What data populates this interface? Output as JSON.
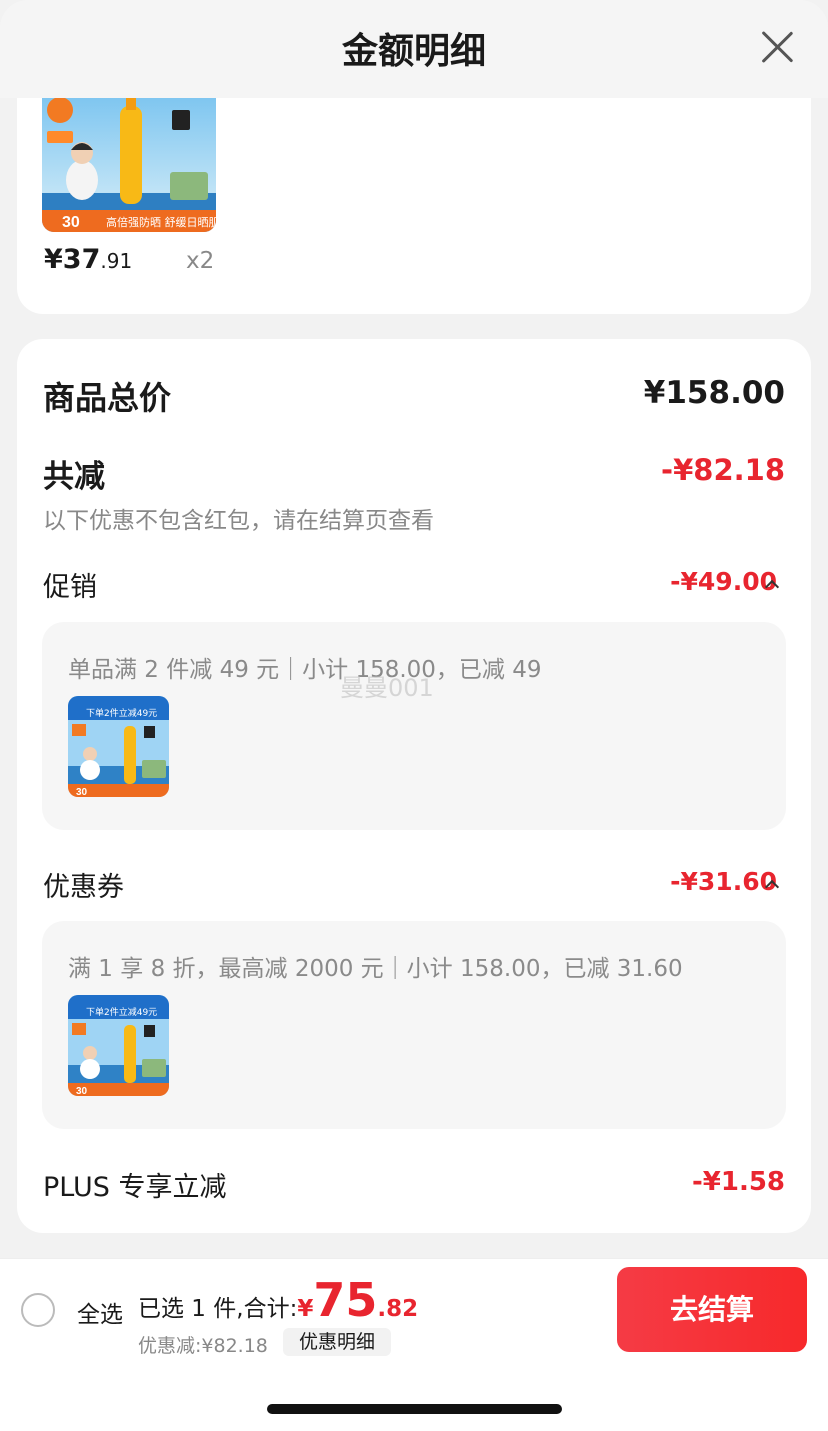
{
  "header": {
    "title": "金额明细"
  },
  "product": {
    "price_int": "¥37",
    "price_dec": ".91",
    "quantity": "x2"
  },
  "summary": {
    "total_label": "商品总价",
    "total_value": "¥158.00",
    "reduce_label": "共减",
    "reduce_value": "-¥82.18",
    "reduce_note": "以下优惠不包含红包，请在结算页查看"
  },
  "promotion": {
    "label": "促销",
    "value": "-¥49.00",
    "detail": "单品满 2 件减 49 元｜小计 158.00，已减 49"
  },
  "coupon": {
    "label": "优惠券",
    "value": "-¥31.60",
    "detail": "满 1 享 8 折，最高减 2000 元｜小计 158.00，已减 31.60"
  },
  "plus": {
    "label": "PLUS 专享立减",
    "value": "-¥1.58"
  },
  "watermark": "曼曼001",
  "bottom": {
    "select_all": "全选",
    "selected_text": "已选 1 件,合计:",
    "currency": "¥",
    "total_int": "75",
    "total_dec": ".82",
    "discount_text": "优惠减:¥82.18",
    "detail_button": "优惠明细",
    "checkout_button": "去结算"
  },
  "colors": {
    "accent_red": "#e8252f",
    "checkout_start": "#f53b45",
    "checkout_end": "#f7292b"
  }
}
